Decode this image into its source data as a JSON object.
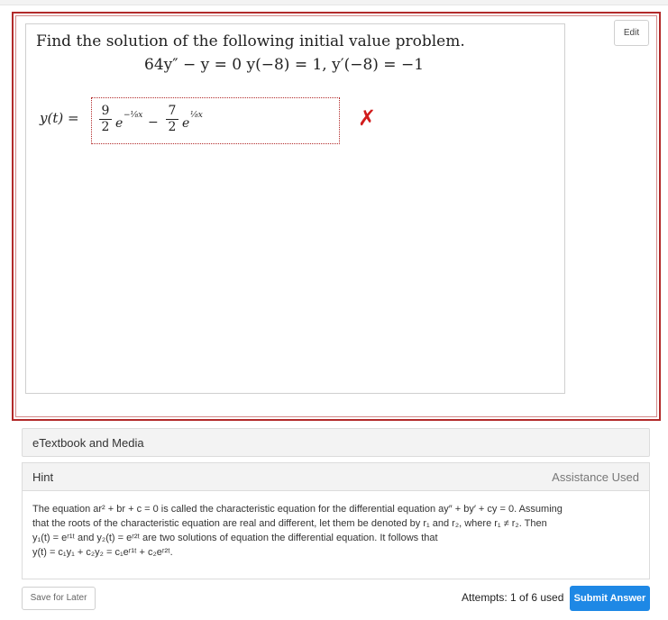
{
  "toolbar": {
    "edit_label": "Edit"
  },
  "question": {
    "prompt": "Find the solution of the following initial value problem.",
    "equation": "64y″ − y = 0   y(−8) = 1, y′(−8) = −1"
  },
  "answer": {
    "label": "y(t) =",
    "term1_num": "9",
    "term1_den": "2",
    "term1_base": "e",
    "term1_exp": "−⅛x",
    "minus": "−",
    "term2_num": "7",
    "term2_den": "2",
    "term2_base": "e",
    "term2_exp": "⅛x",
    "status": "✗"
  },
  "etextbook": {
    "label": "eTextbook and Media"
  },
  "hint": {
    "title": "Hint",
    "assistance": "Assistance Used",
    "line1": "The equation ar² + br + c = 0 is called the characteristic equation for the differential equation ay″ + by′ + cy = 0. Assuming",
    "line2": "that the roots of the characteristic equation are real and different, let them be denoted by r₁ and r₂, where r₁ ≠ r₂. Then",
    "line3": "y₁(t) = eʳ¹ᵗ and y₂(t) = eʳ²ᵗ are two solutions of equation the differential equation. It follows that",
    "line4": "y(t) = c₁y₁ + c₂y₂ = c₁eʳ¹ᵗ + c₂eʳ²ᵗ."
  },
  "footer": {
    "save_label": "Save for Later",
    "attempts": "Attempts: 1 of 6 used",
    "submit_label": "Submit Answer"
  },
  "colors": {
    "error": "#d11c1c",
    "accent": "#1e88e5",
    "frame": "#b22a2a"
  }
}
